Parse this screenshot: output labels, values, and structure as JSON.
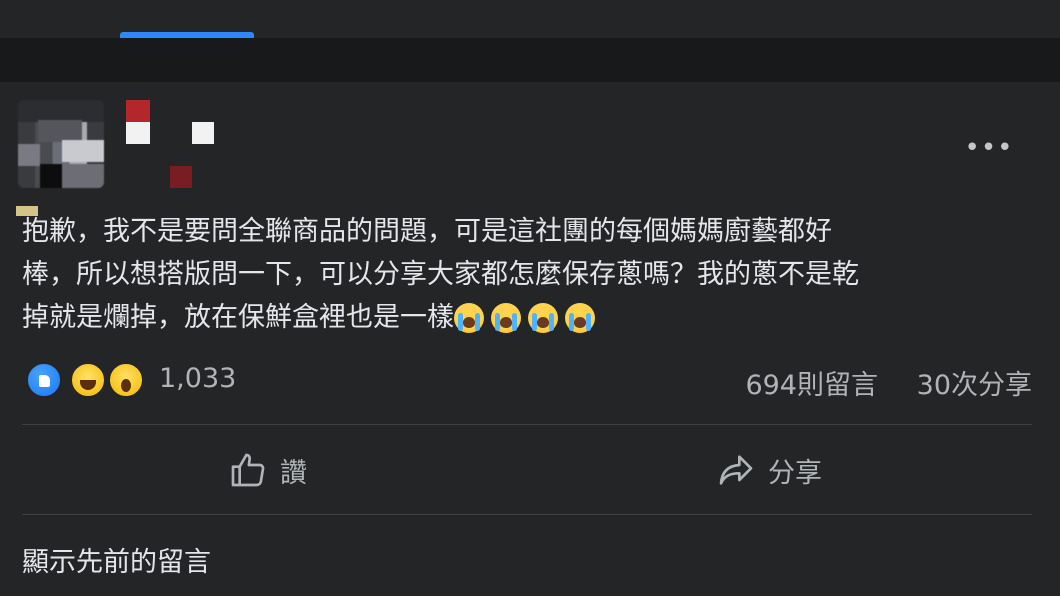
{
  "post": {
    "text_line1": "抱歉，我不是要問全聯商品的問題，可是這社團的每個媽媽廚藝都好",
    "text_line2": "棒，所以想搭版問一下，可以分享大家都怎麼保存蔥嗎？我的蔥不是乾",
    "text_line3": "掉就是爛掉，放在保鮮盒裡也是一樣"
  },
  "stats": {
    "reaction_count": "1,033",
    "comment_count": "694則留言",
    "share_count": "30次分享"
  },
  "actions": {
    "like_label": "讚",
    "share_label": "分享"
  },
  "comments": {
    "previous_label": "顯示先前的留言"
  },
  "icons": {
    "more": "more-options-icon",
    "like": "thumbs-up-icon",
    "share": "share-arrow-icon",
    "reactions": [
      "like-reaction-icon",
      "haha-reaction-icon",
      "wow-reaction-icon"
    ],
    "inline_emoji": [
      "crying-face-emoji",
      "crying-face-emoji",
      "crying-face-emoji",
      "crying-face-emoji"
    ]
  },
  "colors": {
    "background": "#18191a",
    "card": "#242526",
    "accent": "#2d88ff",
    "text_primary": "#e4e6eb",
    "text_secondary": "#b0b3b8"
  }
}
